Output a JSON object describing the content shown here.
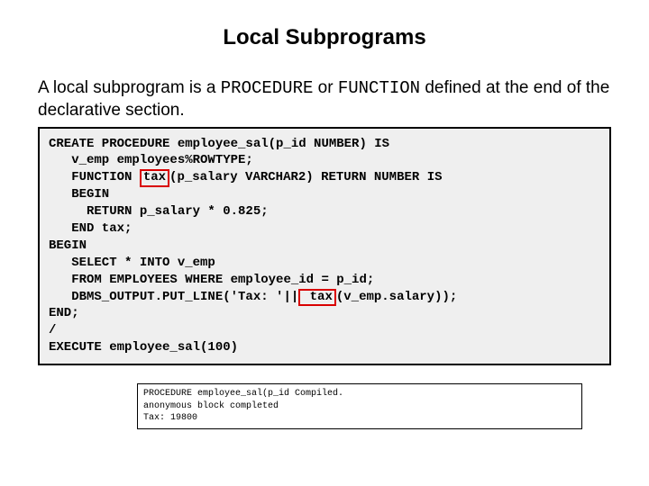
{
  "title": "Local Subprograms",
  "intro": {
    "part1": "A local subprogram is a ",
    "kw1": "PROCEDURE",
    "part2": " or ",
    "kw2": "FUNCTION",
    "part3": " defined at the end of the declarative section."
  },
  "code": {
    "l1": "CREATE PROCEDURE employee_sal(p_id NUMBER) IS",
    "l2": "   v_emp employees%ROWTYPE;",
    "l3a": "   FUNCTION ",
    "l3_hl": "tax",
    "l3b": "(p_salary VARCHAR2) RETURN NUMBER IS",
    "l4": "   BEGIN",
    "l5": "     RETURN p_salary * 0.825;",
    "l6": "   END tax;",
    "l7": "BEGIN",
    "l8": "   SELECT * INTO v_emp",
    "l9": "   FROM EMPLOYEES WHERE employee_id = p_id;",
    "l10a": "   DBMS_OUTPUT.PUT_LINE('Tax: '||",
    "l10_hl": " tax",
    "l10b": "(v_emp.salary));",
    "l11": "END;",
    "l12": "/",
    "l13": "EXECUTE employee_sal(100)"
  },
  "output": {
    "l1": "PROCEDURE employee_sal(p_id Compiled.",
    "l2": "anonymous block completed",
    "l3": "Tax: 19800"
  }
}
